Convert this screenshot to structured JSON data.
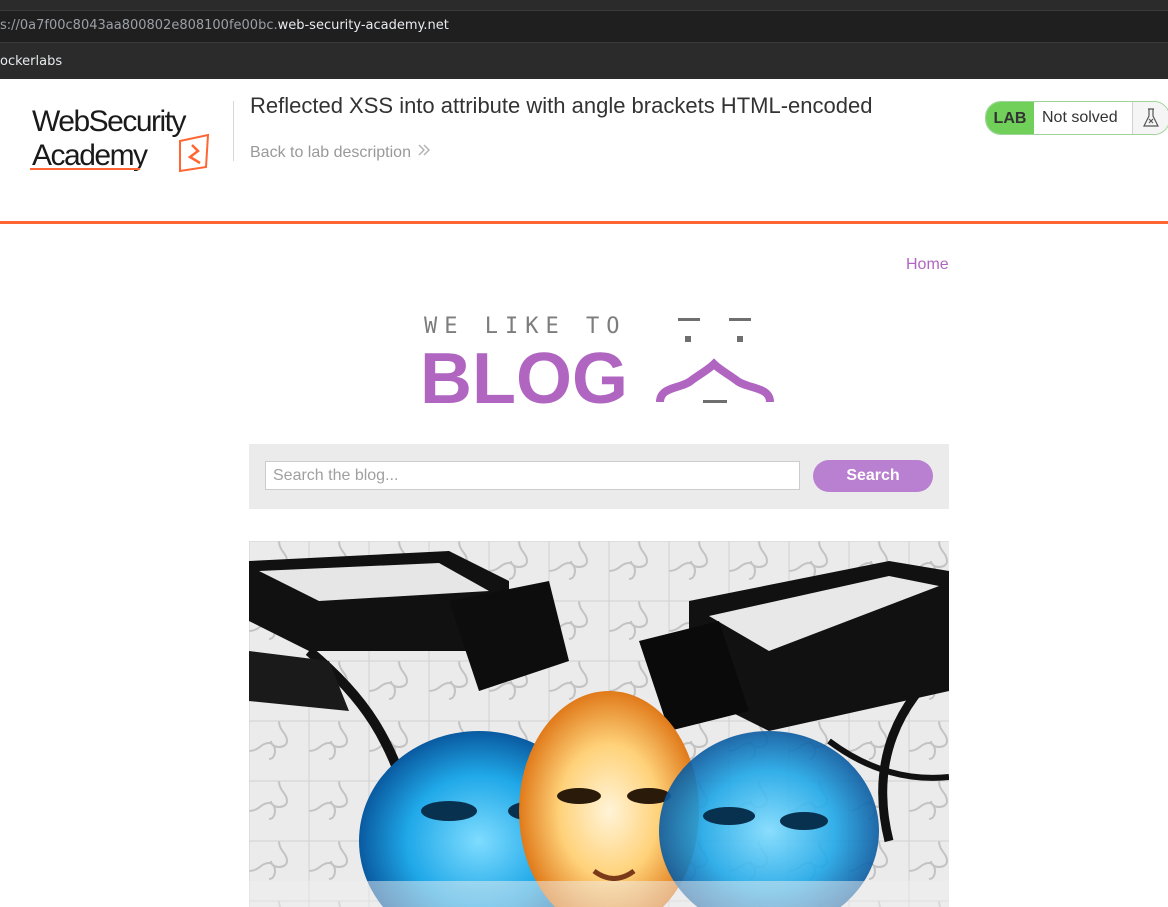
{
  "browser": {
    "url_prefix": "s://0a7f00c8043aa800802e808100fe00bc.",
    "url_domain": "web-security-academy.net",
    "bookmark_label": "ockerlabs"
  },
  "lab": {
    "logo_line1": "WebSecurity",
    "logo_line2": "Academy",
    "title": "Reflected XSS into attribute with angle brackets HTML-encoded",
    "back_link": "Back to lab description",
    "status_badge": "LAB",
    "status_text": "Not solved",
    "accent_color": "#ff6633",
    "status_color": "#70d05a"
  },
  "blog": {
    "nav_home": "Home",
    "logo_tagline": "WE LIKE TO",
    "logo_word": "BLOG",
    "search_placeholder": "Search the blog...",
    "search_button": "Search",
    "brand_color": "#b97fd0"
  }
}
